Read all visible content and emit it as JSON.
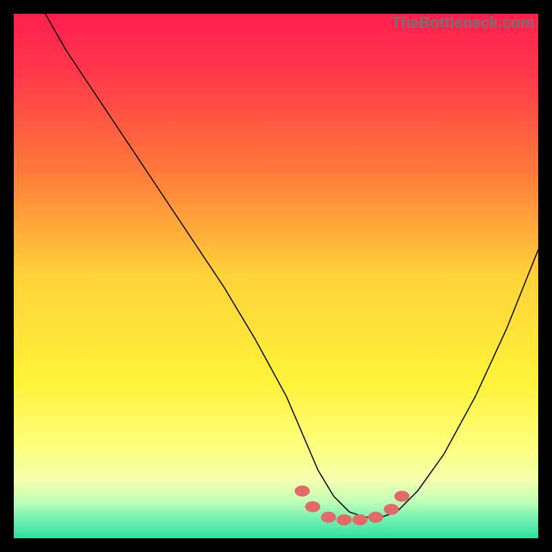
{
  "watermark": "TheBottleneck.com",
  "chart_data": {
    "type": "line",
    "title": "",
    "xlabel": "",
    "ylabel": "",
    "xlim": [
      0,
      100
    ],
    "ylim": [
      0,
      100
    ],
    "grid": false,
    "legend": false,
    "background": {
      "type": "vertical-gradient",
      "stops": [
        {
          "pos": 0.0,
          "color": "#ff1f4f"
        },
        {
          "pos": 0.12,
          "color": "#ff3a4a"
        },
        {
          "pos": 0.3,
          "color": "#ff7a3a"
        },
        {
          "pos": 0.5,
          "color": "#ffd23a"
        },
        {
          "pos": 0.7,
          "color": "#fff23a"
        },
        {
          "pos": 0.82,
          "color": "#fdff7a"
        },
        {
          "pos": 0.9,
          "color": "#d6ffb0"
        },
        {
          "pos": 0.95,
          "color": "#8effb0"
        },
        {
          "pos": 1.0,
          "color": "#2fe9a0"
        }
      ]
    },
    "series": [
      {
        "name": "bottleneck-curve",
        "stroke": "#000000",
        "stroke_width": 1.6,
        "x": [
          6,
          10,
          16,
          22,
          28,
          34,
          40,
          46,
          52,
          55,
          58,
          61,
          64,
          67,
          70,
          73,
          77,
          82,
          88,
          94,
          100
        ],
        "y": [
          100,
          93,
          84,
          75,
          66,
          57,
          48,
          38,
          27,
          20,
          13,
          8,
          5,
          4,
          4,
          5,
          9,
          16,
          27,
          40,
          55
        ]
      },
      {
        "name": "highlight-points",
        "type": "scatter",
        "stroke": "#e36a6a",
        "fill": "#e36a6a",
        "radius": 8,
        "x": [
          55,
          57,
          60,
          63,
          66,
          69,
          72,
          74
        ],
        "y": [
          9,
          6,
          4,
          3.5,
          3.5,
          4,
          5.5,
          8
        ]
      }
    ]
  }
}
